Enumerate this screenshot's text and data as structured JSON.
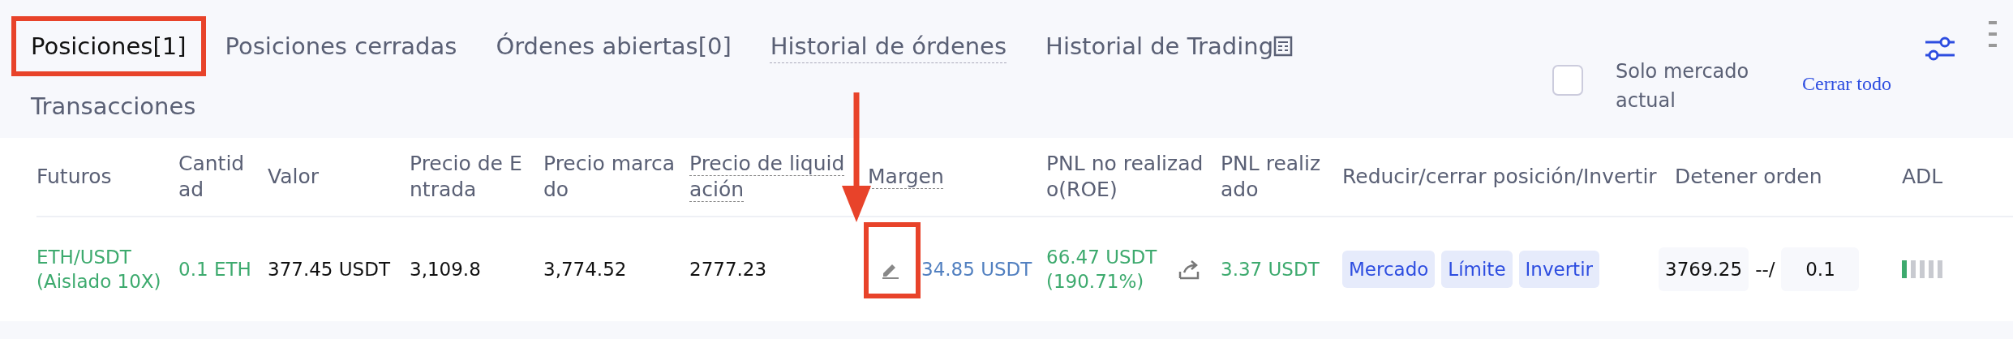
{
  "tabs": [
    {
      "label": "Posiciones[1]",
      "selected": true,
      "highlighted": true,
      "hint": false,
      "icon": false
    },
    {
      "label": "Posiciones cerradas",
      "selected": false,
      "highlighted": false,
      "hint": false,
      "icon": false
    },
    {
      "label": "Órdenes abiertas[0]",
      "selected": false,
      "highlighted": false,
      "hint": false,
      "icon": false
    },
    {
      "label": "Historial de órdenes",
      "selected": false,
      "highlighted": false,
      "hint": true,
      "icon": false
    },
    {
      "label": "Historial de Trading",
      "selected": false,
      "highlighted": false,
      "hint": false,
      "icon": true
    },
    {
      "label": "Transacciones",
      "selected": false,
      "highlighted": false,
      "hint": false,
      "icon": false
    }
  ],
  "filter": {
    "label": "Solo mercado actual",
    "checked": false
  },
  "close_all": "Cerrar todo",
  "table": {
    "columns": [
      {
        "label": "Futuros",
        "hint": false
      },
      {
        "label": "Cantidad",
        "hint": false
      },
      {
        "label": "Valor",
        "hint": false
      },
      {
        "label": "Precio de Entrada",
        "hint": false
      },
      {
        "label": "Precio marcado",
        "hint": false
      },
      {
        "label": "Precio de liquidación",
        "hint": true
      },
      {
        "label": "Margen",
        "hint": true
      },
      {
        "label": "PNL no realizado(ROE)",
        "hint": false
      },
      {
        "label": "PNL realizado",
        "hint": false
      },
      {
        "label": "Reducir/cerrar posición/Invertir",
        "hint": false
      },
      {
        "label": "Detener orden",
        "hint": false
      },
      {
        "label": "ADL",
        "hint": false
      }
    ],
    "rows": [
      {
        "pair": "ETH/USDT",
        "mode": "(Aislado 10X)",
        "quantity": "0.1 ETH",
        "value": "377.45 USDT",
        "entry_price": "3,109.8",
        "mark_price": "3,774.52",
        "liquidation_price": "2777.23",
        "margin": {
          "value": "34.85 USDT",
          "highlighted": true
        },
        "unrealized_pnl": "66.47 USDT",
        "roe": "(190.71%)",
        "realized_pnl": "3.37 USDT",
        "actions": [
          "Mercado",
          "Límite",
          "Invertir"
        ],
        "stop": {
          "price": "3769.25",
          "separator": "--/",
          "quantity": "0.1"
        },
        "adl": {
          "kind": "indicator"
        }
      }
    ]
  }
}
